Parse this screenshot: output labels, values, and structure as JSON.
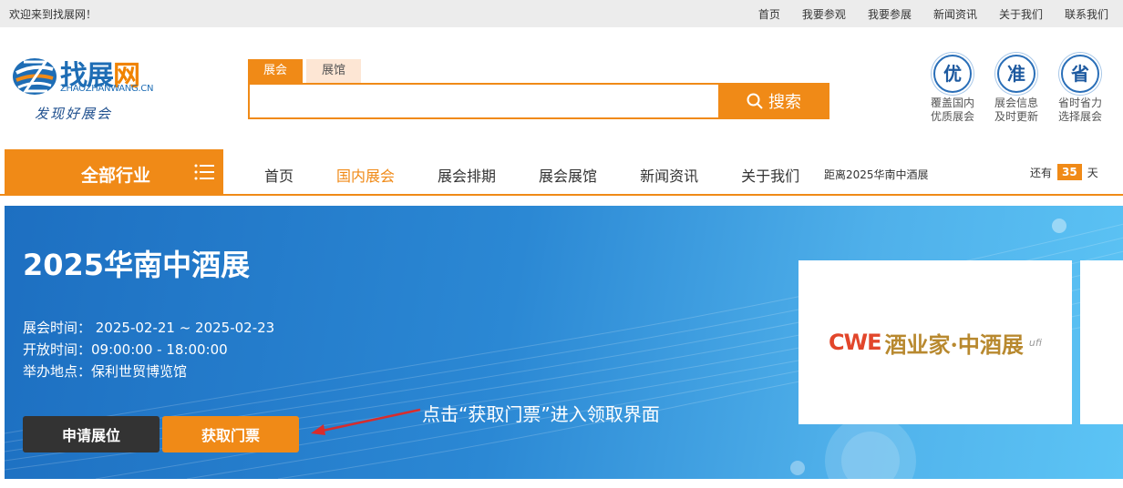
{
  "topbar": {
    "welcome": "欢迎来到找展网！",
    "links": [
      "首页",
      "我要参观",
      "我要参展",
      "新闻资讯",
      "关于我们",
      "联系我们"
    ]
  },
  "logo": {
    "name_main": "找展",
    "name_w": "网",
    "domain": "ZHAOZHANWANG.CN",
    "slogan": "发现好展会"
  },
  "search": {
    "tab_active": "展会",
    "tab_inactive": "展馆",
    "input_value": "",
    "button_label": "搜索"
  },
  "features": [
    {
      "char": "优",
      "line1": "覆盖国内",
      "line2": "优质展会"
    },
    {
      "char": "准",
      "line1": "展会信息",
      "line2": "及时更新"
    },
    {
      "char": "省",
      "line1": "省时省力",
      "line2": "选择展会"
    }
  ],
  "nav": {
    "all_label": "全部行业",
    "items": [
      "首页",
      "国内展会",
      "展会排期",
      "展会展馆",
      "新闻资讯",
      "关于我们"
    ],
    "active_index": 1,
    "countdown_label": "距离2025华南中酒展",
    "countdown_prefix": "还有",
    "countdown_days": "35",
    "countdown_suffix": "天"
  },
  "banner": {
    "title": "2025华南中酒展",
    "time": "展会时间： 2025-02-21 ~ 2025-02-23",
    "open": "开放时间：09:00:00 - 18:00:00",
    "venue": "举办地点：保利世贸博览馆",
    "apply_label": "申请展位",
    "ticket_label": "获取门票",
    "hint": "点击“获取门票”进入领取界面",
    "poster_brand": "CWE",
    "poster_cn": "酒业家·中酒展",
    "poster_ufi": "ufi"
  },
  "colors": {
    "accent": "#f08a17",
    "brand_blue": "#1e6db5",
    "banner_dark": "#1d6fc1",
    "banner_light": "#5cc4f5"
  }
}
